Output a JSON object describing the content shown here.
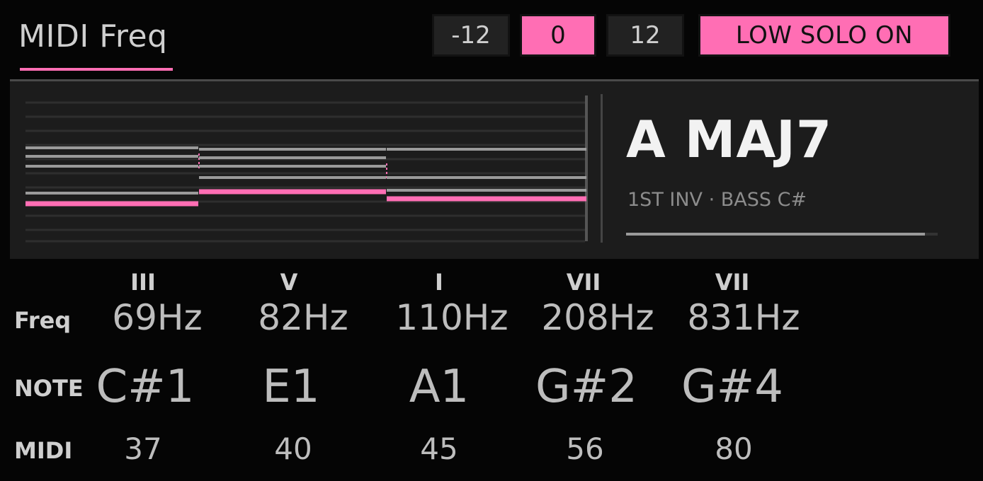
{
  "header": {
    "title": "MIDI Freq",
    "transpose_buttons": [
      {
        "label": "-12",
        "active": false
      },
      {
        "label": "0",
        "active": true
      },
      {
        "label": "12",
        "active": false
      }
    ],
    "solo_button": "LOW SOLO ON"
  },
  "chord": {
    "name": "A MAJ7",
    "subtitle": "1ST INV · BASS C#",
    "progress_fraction": 0.96
  },
  "table": {
    "labels": {
      "freq": "Freq",
      "note": "NOTE",
      "midi": "MIDI"
    },
    "columns": [
      {
        "degree": "III",
        "freq": "69Hz",
        "note": "C#1",
        "midi": "37"
      },
      {
        "degree": "V",
        "freq": "82Hz",
        "note": "E1",
        "midi": "40"
      },
      {
        "degree": "I",
        "freq": "110Hz",
        "note": "A1",
        "midi": "45"
      },
      {
        "degree": "VII",
        "freq": "208Hz",
        "note": "G#2",
        "midi": "56"
      },
      {
        "degree": "VII",
        "freq": "831Hz",
        "note": "G#4",
        "midi": "80"
      }
    ]
  },
  "colors": {
    "accent": "#ff6eb4",
    "background": "#050505",
    "panel": "#1c1c1c"
  }
}
